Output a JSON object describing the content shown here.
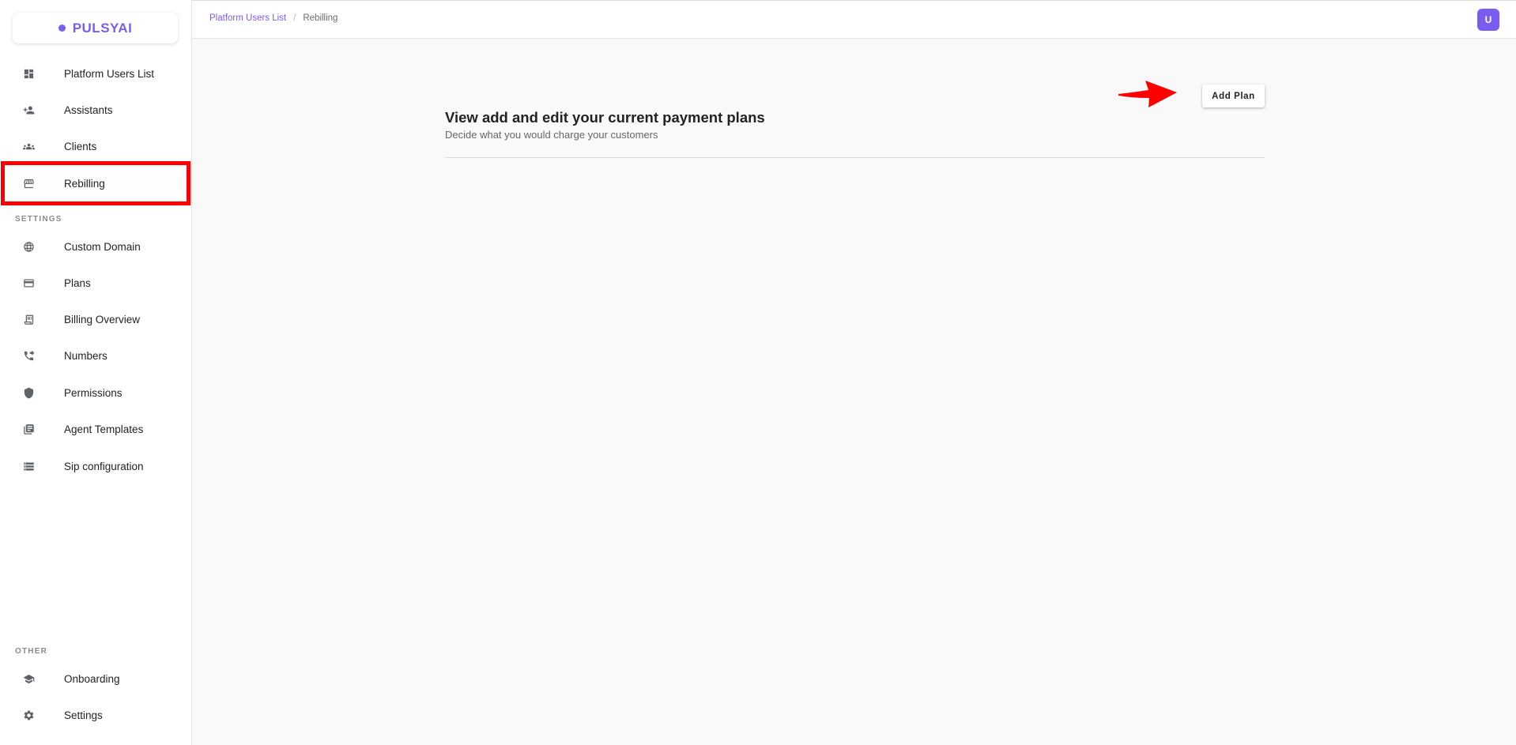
{
  "brand": {
    "name": "PULSYAI",
    "accent": "#7b5cf0"
  },
  "sidebar": {
    "items": [
      {
        "label": "Platform Users List",
        "icon": "dashboard-icon"
      },
      {
        "label": "Assistants",
        "icon": "person-add-icon"
      },
      {
        "label": "Clients",
        "icon": "group-icon"
      },
      {
        "label": "Rebilling",
        "icon": "storefront-icon"
      }
    ],
    "settings_label": "SETTINGS",
    "settings_items": [
      {
        "label": "Custom Domain",
        "icon": "globe-icon"
      },
      {
        "label": "Plans",
        "icon": "credit-card-icon"
      },
      {
        "label": "Billing Overview",
        "icon": "receipt-icon"
      },
      {
        "label": "Numbers",
        "icon": "phone-forward-icon"
      },
      {
        "label": "Permissions",
        "icon": "shield-icon"
      },
      {
        "label": "Agent Templates",
        "icon": "library-books-icon"
      },
      {
        "label": "Sip configuration",
        "icon": "storage-icon"
      }
    ],
    "other_label": "OTHER",
    "other_items": [
      {
        "label": "Onboarding",
        "icon": "school-icon"
      },
      {
        "label": "Settings",
        "icon": "gear-icon"
      }
    ]
  },
  "breadcrumb": {
    "parent": "Platform Users List",
    "separator": "/",
    "current": "Rebilling"
  },
  "user": {
    "initial": "U"
  },
  "main": {
    "title": "View add and edit your current payment plans",
    "subtitle": "Decide what you would charge your customers",
    "add_button": "Add Plan"
  }
}
